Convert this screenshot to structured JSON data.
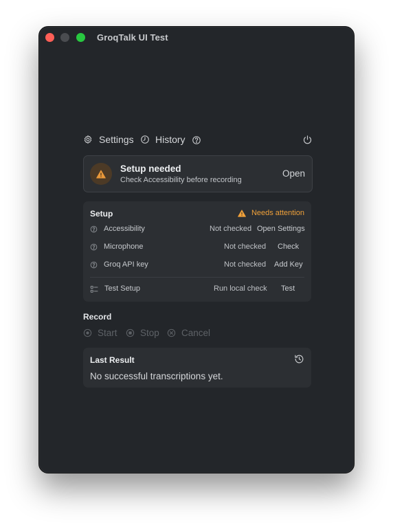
{
  "window": {
    "title": "GroqTalk UI Test"
  },
  "toolbar": {
    "settings_label": "Settings",
    "history_label": "History",
    "icons": [
      "gear-icon",
      "clock-icon",
      "help-icon",
      "power-icon"
    ]
  },
  "alert": {
    "title": "Setup needed",
    "subtitle": "Check Accessibility before recording",
    "action_label": "Open",
    "icon": "warning-icon",
    "accent_color": "#f0a13a"
  },
  "setup": {
    "title": "Setup",
    "status_label": "Needs attention",
    "status_color": "#f0a13a",
    "items": [
      {
        "label": "Accessibility",
        "state": "Not checked",
        "action": "Open Settings",
        "icon": "help-icon"
      },
      {
        "label": "Microphone",
        "state": "Not checked",
        "action": "Check",
        "icon": "help-icon"
      },
      {
        "label": "Groq API key",
        "state": "Not checked",
        "action": "Add Key",
        "icon": "help-icon"
      }
    ],
    "test": {
      "label": "Test Setup",
      "state": "Run local check",
      "action": "Test",
      "icon": "checklist-icon"
    }
  },
  "record": {
    "heading": "Record",
    "start_label": "Start",
    "stop_label": "Stop",
    "cancel_label": "Cancel"
  },
  "last_result": {
    "title": "Last Result",
    "message": "No successful transcriptions yet.",
    "icon": "history-icon"
  }
}
